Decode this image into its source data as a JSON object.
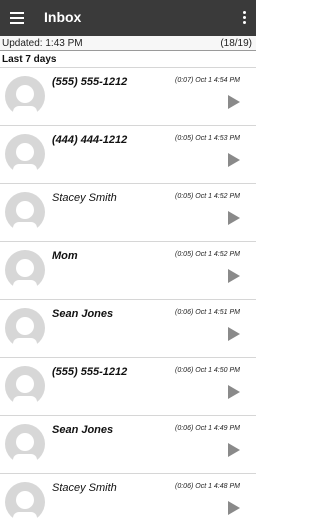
{
  "appbar": {
    "title": "Inbox",
    "menu_icon": "hamburger-icon",
    "more_icon": "more-vert-icon"
  },
  "status": {
    "updated": "Updated: 1:43 PM",
    "count": "(18/19)"
  },
  "section_label": "Last 7 days",
  "messages": [
    {
      "name": "(555) 555-1212",
      "meta": "(0:07)  Oct 1 4:54 PM",
      "style": "bold"
    },
    {
      "name": "(444) 444-1212",
      "meta": "(0:05)  Oct 1 4:53 PM",
      "style": "bold"
    },
    {
      "name": "Stacey Smith",
      "meta": "(0:05)  Oct 1 4:52 PM",
      "style": "italic"
    },
    {
      "name": "Mom",
      "meta": "(0:05)  Oct 1 4:52 PM",
      "style": "bold"
    },
    {
      "name": "Sean Jones",
      "meta": "(0:06)  Oct 1 4:51 PM",
      "style": "bold"
    },
    {
      "name": "(555) 555-1212",
      "meta": "(0:06)  Oct 1 4:50 PM",
      "style": "bold"
    },
    {
      "name": "Sean Jones",
      "meta": "(0:06)  Oct 1 4:49 PM",
      "style": "bold"
    },
    {
      "name": "Stacey Smith",
      "meta": "(0:06)  Oct 1 4:48 PM",
      "style": "italic"
    }
  ]
}
